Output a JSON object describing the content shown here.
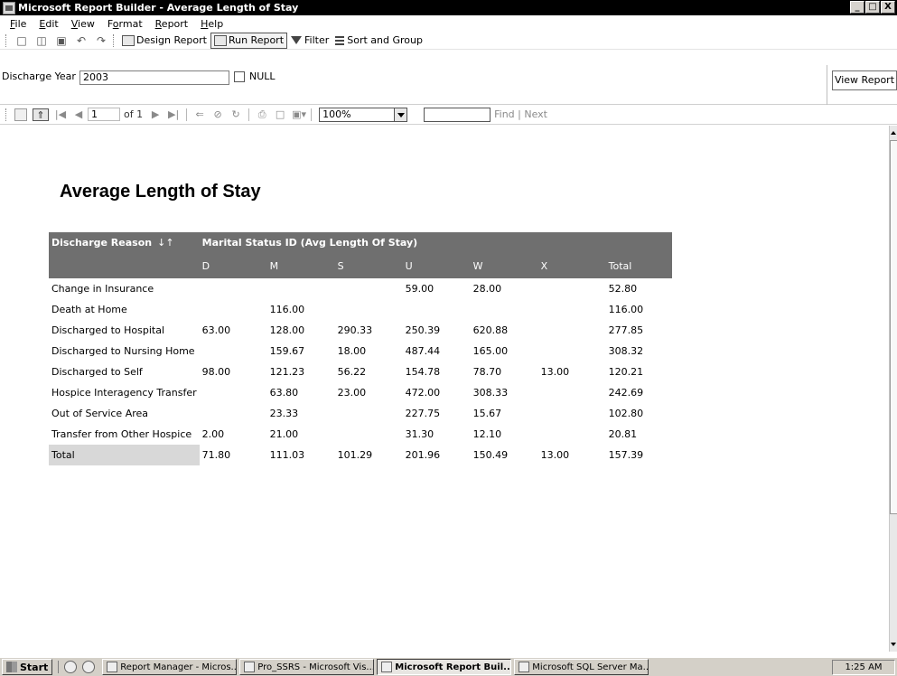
{
  "window": {
    "title": "Microsoft Report Builder - Average Length of Stay",
    "controls": [
      "_",
      "□",
      "X"
    ]
  },
  "menu": [
    {
      "label": "File",
      "key": "F",
      "rest": "ile"
    },
    {
      "label": "Edit",
      "key": "E",
      "rest": "dit"
    },
    {
      "label": "View",
      "key": "V",
      "rest": "iew"
    },
    {
      "label": "Format",
      "pre": "F",
      "key": "o",
      "rest": "rmat"
    },
    {
      "label": "Report",
      "key": "R",
      "rest": "eport"
    },
    {
      "label": "Help",
      "key": "H",
      "rest": "elp"
    }
  ],
  "toolbar": {
    "design_report": "Design Report",
    "run_report": "Run Report",
    "filter": "Filter",
    "sort_and_group": "Sort and Group"
  },
  "parameters": {
    "discharge_year_label": "Discharge Year",
    "discharge_year_value": "2003",
    "null_label": "NULL",
    "null_checked": false,
    "view_report_button": "View Report"
  },
  "navigation": {
    "current_page": "1",
    "page_of": "of 1",
    "zoom": "100%",
    "find_value": "",
    "find_next": "Find | Next"
  },
  "report": {
    "title": "Average Length of Stay",
    "header": {
      "row_label": "Discharge Reason",
      "sort_icon": "↓↑",
      "column_group": "Marital Status ID (Avg Length Of Stay)"
    },
    "columns": [
      "D",
      "M",
      "S",
      "U",
      "W",
      "X",
      "Total"
    ],
    "rows": [
      {
        "reason": "Change in Insurance",
        "values": [
          "",
          "",
          "",
          "59.00",
          "28.00",
          "",
          "52.80"
        ]
      },
      {
        "reason": "Death at Home",
        "values": [
          "",
          "116.00",
          "",
          "",
          "",
          "",
          "116.00"
        ]
      },
      {
        "reason": "Discharged to Hospital",
        "values": [
          "63.00",
          "128.00",
          "290.33",
          "250.39",
          "620.88",
          "",
          "277.85"
        ]
      },
      {
        "reason": "Discharged to Nursing Home",
        "values": [
          "",
          "159.67",
          "18.00",
          "487.44",
          "165.00",
          "",
          "308.32"
        ]
      },
      {
        "reason": "Discharged to Self",
        "values": [
          "98.00",
          "121.23",
          "56.22",
          "154.78",
          "78.70",
          "13.00",
          "120.21"
        ]
      },
      {
        "reason": "Hospice Interagency Transfer",
        "values": [
          "",
          "63.80",
          "23.00",
          "472.00",
          "308.33",
          "",
          "242.69"
        ]
      },
      {
        "reason": "Out of Service Area",
        "values": [
          "",
          "23.33",
          "",
          "227.75",
          "15.67",
          "",
          "102.80"
        ]
      },
      {
        "reason": "Transfer from Other Hospice",
        "values": [
          "2.00",
          "21.00",
          "",
          "31.30",
          "12.10",
          "",
          "20.81"
        ]
      }
    ],
    "total_row": {
      "reason": "Total",
      "values": [
        "71.80",
        "111.03",
        "101.29",
        "201.96",
        "150.49",
        "13.00",
        "157.39"
      ]
    }
  },
  "taskbar": {
    "start": "Start",
    "tasks": [
      {
        "label": "Report Manager - Micros...",
        "active": false
      },
      {
        "label": "Pro_SSRS - Microsoft Vis...",
        "active": false
      },
      {
        "label": "Microsoft Report Buil...",
        "active": true
      },
      {
        "label": "Microsoft SQL Server Ma...",
        "active": false
      }
    ],
    "clock": "1:25 AM"
  },
  "icons": {
    "app": "report-builder-icon",
    "new": "new-document-icon",
    "open": "open-folder-icon",
    "save": "save-icon",
    "undo": "undo-icon",
    "redo": "redo-icon"
  }
}
